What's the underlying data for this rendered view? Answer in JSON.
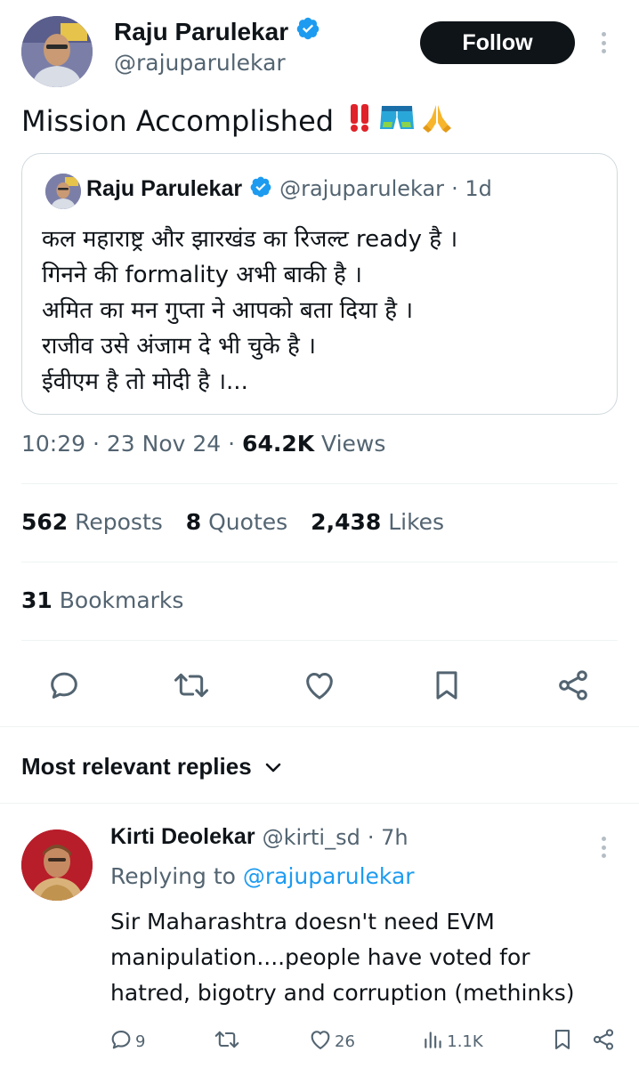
{
  "author": {
    "name": "Raju Parulekar",
    "handle": "@rajuparulekar",
    "verified_color": "#1d9bf0"
  },
  "follow_label": "Follow",
  "tweet": {
    "text": "Mission Accomplished",
    "emojis": [
      "double-exclamation-icon",
      "shorts-icon",
      "folded-hands-icon"
    ]
  },
  "quote": {
    "name": "Raju Parulekar",
    "handle": "@rajuparulekar",
    "time": "· 1d",
    "lines": [
      "कल महाराष्ट्र और झारखंड का रिजल्ट ready है ।",
      "गिनने की formality अभी बाकी है ।",
      "अमित का मन गुप्ता ने आपको बता दिया है ।",
      "राजीव उसे अंजाम दे भी चुके है ।",
      "ईवीएम है तो मोदी है ।..."
    ]
  },
  "meta": {
    "time": "10:29",
    "sep1": " · ",
    "date": "23 Nov 24",
    "sep2": " · ",
    "views_count": "64.2K",
    "views_label": " Views"
  },
  "stats": {
    "reposts_count": "562",
    "reposts_label": " Reposts",
    "quotes_count": "8",
    "quotes_label": " Quotes",
    "likes_count": "2,438",
    "likes_label": " Likes",
    "bookmarks_count": "31",
    "bookmarks_label": " Bookmarks"
  },
  "replies_heading": "Most relevant replies",
  "reply": {
    "name": "Kirti Deolekar",
    "handle": "@kirti_sd",
    "time": "· 7h",
    "replying_prefix": "Replying to ",
    "replying_handle": "@rajuparulekar",
    "lines": [
      "Sir Maharashtra doesn't need EVM",
      "manipulation....people have voted for",
      "hatred, bigotry and corruption (methinks)"
    ],
    "replies": "9",
    "likes": "26",
    "views": "1.1K"
  },
  "colors": {
    "text": "#0f1419",
    "secondary": "#536471",
    "accent": "#1d9bf0",
    "border": "#cfd9de"
  }
}
